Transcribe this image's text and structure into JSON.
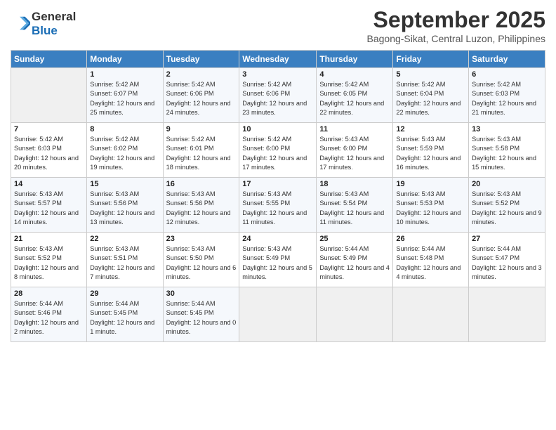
{
  "header": {
    "logo_line1": "General",
    "logo_line2": "Blue",
    "month": "September 2025",
    "location": "Bagong-Sikat, Central Luzon, Philippines"
  },
  "weekdays": [
    "Sunday",
    "Monday",
    "Tuesday",
    "Wednesday",
    "Thursday",
    "Friday",
    "Saturday"
  ],
  "weeks": [
    [
      {
        "day": "",
        "sunrise": "",
        "sunset": "",
        "daylight": ""
      },
      {
        "day": "1",
        "sunrise": "Sunrise: 5:42 AM",
        "sunset": "Sunset: 6:07 PM",
        "daylight": "Daylight: 12 hours and 25 minutes."
      },
      {
        "day": "2",
        "sunrise": "Sunrise: 5:42 AM",
        "sunset": "Sunset: 6:06 PM",
        "daylight": "Daylight: 12 hours and 24 minutes."
      },
      {
        "day": "3",
        "sunrise": "Sunrise: 5:42 AM",
        "sunset": "Sunset: 6:06 PM",
        "daylight": "Daylight: 12 hours and 23 minutes."
      },
      {
        "day": "4",
        "sunrise": "Sunrise: 5:42 AM",
        "sunset": "Sunset: 6:05 PM",
        "daylight": "Daylight: 12 hours and 22 minutes."
      },
      {
        "day": "5",
        "sunrise": "Sunrise: 5:42 AM",
        "sunset": "Sunset: 6:04 PM",
        "daylight": "Daylight: 12 hours and 22 minutes."
      },
      {
        "day": "6",
        "sunrise": "Sunrise: 5:42 AM",
        "sunset": "Sunset: 6:03 PM",
        "daylight": "Daylight: 12 hours and 21 minutes."
      }
    ],
    [
      {
        "day": "7",
        "sunrise": "Sunrise: 5:42 AM",
        "sunset": "Sunset: 6:03 PM",
        "daylight": "Daylight: 12 hours and 20 minutes."
      },
      {
        "day": "8",
        "sunrise": "Sunrise: 5:42 AM",
        "sunset": "Sunset: 6:02 PM",
        "daylight": "Daylight: 12 hours and 19 minutes."
      },
      {
        "day": "9",
        "sunrise": "Sunrise: 5:42 AM",
        "sunset": "Sunset: 6:01 PM",
        "daylight": "Daylight: 12 hours and 18 minutes."
      },
      {
        "day": "10",
        "sunrise": "Sunrise: 5:42 AM",
        "sunset": "Sunset: 6:00 PM",
        "daylight": "Daylight: 12 hours and 17 minutes."
      },
      {
        "day": "11",
        "sunrise": "Sunrise: 5:43 AM",
        "sunset": "Sunset: 6:00 PM",
        "daylight": "Daylight: 12 hours and 17 minutes."
      },
      {
        "day": "12",
        "sunrise": "Sunrise: 5:43 AM",
        "sunset": "Sunset: 5:59 PM",
        "daylight": "Daylight: 12 hours and 16 minutes."
      },
      {
        "day": "13",
        "sunrise": "Sunrise: 5:43 AM",
        "sunset": "Sunset: 5:58 PM",
        "daylight": "Daylight: 12 hours and 15 minutes."
      }
    ],
    [
      {
        "day": "14",
        "sunrise": "Sunrise: 5:43 AM",
        "sunset": "Sunset: 5:57 PM",
        "daylight": "Daylight: 12 hours and 14 minutes."
      },
      {
        "day": "15",
        "sunrise": "Sunrise: 5:43 AM",
        "sunset": "Sunset: 5:56 PM",
        "daylight": "Daylight: 12 hours and 13 minutes."
      },
      {
        "day": "16",
        "sunrise": "Sunrise: 5:43 AM",
        "sunset": "Sunset: 5:56 PM",
        "daylight": "Daylight: 12 hours and 12 minutes."
      },
      {
        "day": "17",
        "sunrise": "Sunrise: 5:43 AM",
        "sunset": "Sunset: 5:55 PM",
        "daylight": "Daylight: 12 hours and 11 minutes."
      },
      {
        "day": "18",
        "sunrise": "Sunrise: 5:43 AM",
        "sunset": "Sunset: 5:54 PM",
        "daylight": "Daylight: 12 hours and 11 minutes."
      },
      {
        "day": "19",
        "sunrise": "Sunrise: 5:43 AM",
        "sunset": "Sunset: 5:53 PM",
        "daylight": "Daylight: 12 hours and 10 minutes."
      },
      {
        "day": "20",
        "sunrise": "Sunrise: 5:43 AM",
        "sunset": "Sunset: 5:52 PM",
        "daylight": "Daylight: 12 hours and 9 minutes."
      }
    ],
    [
      {
        "day": "21",
        "sunrise": "Sunrise: 5:43 AM",
        "sunset": "Sunset: 5:52 PM",
        "daylight": "Daylight: 12 hours and 8 minutes."
      },
      {
        "day": "22",
        "sunrise": "Sunrise: 5:43 AM",
        "sunset": "Sunset: 5:51 PM",
        "daylight": "Daylight: 12 hours and 7 minutes."
      },
      {
        "day": "23",
        "sunrise": "Sunrise: 5:43 AM",
        "sunset": "Sunset: 5:50 PM",
        "daylight": "Daylight: 12 hours and 6 minutes."
      },
      {
        "day": "24",
        "sunrise": "Sunrise: 5:43 AM",
        "sunset": "Sunset: 5:49 PM",
        "daylight": "Daylight: 12 hours and 5 minutes."
      },
      {
        "day": "25",
        "sunrise": "Sunrise: 5:44 AM",
        "sunset": "Sunset: 5:49 PM",
        "daylight": "Daylight: 12 hours and 4 minutes."
      },
      {
        "day": "26",
        "sunrise": "Sunrise: 5:44 AM",
        "sunset": "Sunset: 5:48 PM",
        "daylight": "Daylight: 12 hours and 4 minutes."
      },
      {
        "day": "27",
        "sunrise": "Sunrise: 5:44 AM",
        "sunset": "Sunset: 5:47 PM",
        "daylight": "Daylight: 12 hours and 3 minutes."
      }
    ],
    [
      {
        "day": "28",
        "sunrise": "Sunrise: 5:44 AM",
        "sunset": "Sunset: 5:46 PM",
        "daylight": "Daylight: 12 hours and 2 minutes."
      },
      {
        "day": "29",
        "sunrise": "Sunrise: 5:44 AM",
        "sunset": "Sunset: 5:45 PM",
        "daylight": "Daylight: 12 hours and 1 minute."
      },
      {
        "day": "30",
        "sunrise": "Sunrise: 5:44 AM",
        "sunset": "Sunset: 5:45 PM",
        "daylight": "Daylight: 12 hours and 0 minutes."
      },
      {
        "day": "",
        "sunrise": "",
        "sunset": "",
        "daylight": ""
      },
      {
        "day": "",
        "sunrise": "",
        "sunset": "",
        "daylight": ""
      },
      {
        "day": "",
        "sunrise": "",
        "sunset": "",
        "daylight": ""
      },
      {
        "day": "",
        "sunrise": "",
        "sunset": "",
        "daylight": ""
      }
    ]
  ]
}
